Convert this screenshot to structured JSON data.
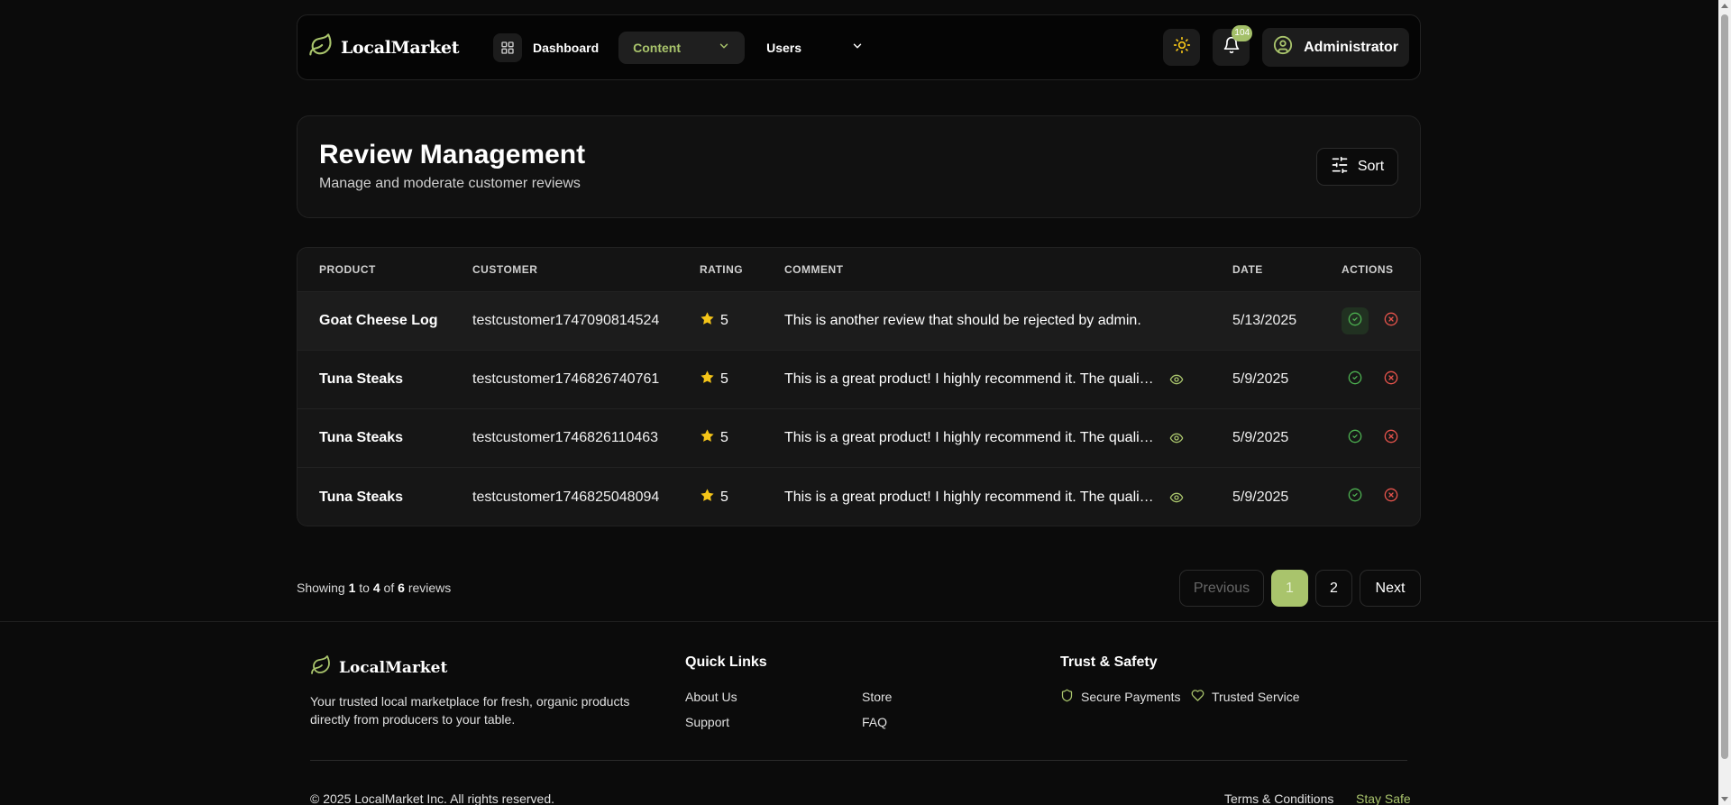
{
  "colors": {
    "accent": "#a9c46c",
    "background": "#0b0b0b",
    "star": "#f5c518",
    "approve": "#4caf50",
    "reject": "#e5534b"
  },
  "nav": {
    "brand": "LocalMarket",
    "dashboard": "Dashboard",
    "content": "Content",
    "users": "Users",
    "notification_count": "104",
    "user_label": "Administrator"
  },
  "header": {
    "title": "Review Management",
    "subtitle": "Manage and moderate customer reviews",
    "sort_label": "Sort"
  },
  "table": {
    "columns": {
      "product": "PRODUCT",
      "customer": "CUSTOMER",
      "rating": "RATING",
      "comment": "COMMENT",
      "date": "DATE",
      "actions": "ACTIONS"
    },
    "rows": [
      {
        "product": "Goat Cheese Log",
        "customer": "testcustomer1747090814524",
        "rating": "5",
        "comment": "This is another review that should be rejected by admin.",
        "date": "5/13/2025"
      },
      {
        "product": "Tuna Steaks",
        "customer": "testcustomer1746826740761",
        "rating": "5",
        "comment": "This is a great product! I highly recommend it. The quality is excellent.",
        "date": "5/9/2025"
      },
      {
        "product": "Tuna Steaks",
        "customer": "testcustomer1746826110463",
        "rating": "5",
        "comment": "This is a great product! I highly recommend it. The quality is excellent.",
        "date": "5/9/2025"
      },
      {
        "product": "Tuna Steaks",
        "customer": "testcustomer1746825048094",
        "rating": "5",
        "comment": "This is a great product! I highly recommend it. The quality is excellent.",
        "date": "5/9/2025"
      }
    ]
  },
  "pagination": {
    "showing_prefix": "Showing",
    "from": "1",
    "to_word": "to",
    "to": "4",
    "of_word": "of",
    "total": "6",
    "suffix": "reviews",
    "previous": "Previous",
    "page1": "1",
    "page2": "2",
    "next": "Next"
  },
  "footer": {
    "brand": "LocalMarket",
    "description": "Your trusted local marketplace for fresh, organic products directly from producers to your table.",
    "quick_links_heading": "Quick Links",
    "links": {
      "about": "About Us",
      "store": "Store",
      "support": "Support",
      "faq": "FAQ"
    },
    "trust_heading": "Trust & Safety",
    "secure_payments": "Secure Payments",
    "trusted_service": "Trusted Service",
    "copyright": "© 2025 LocalMarket Inc. All rights reserved.",
    "terms": "Terms & Conditions",
    "stay_safe": "Stay Safe"
  }
}
